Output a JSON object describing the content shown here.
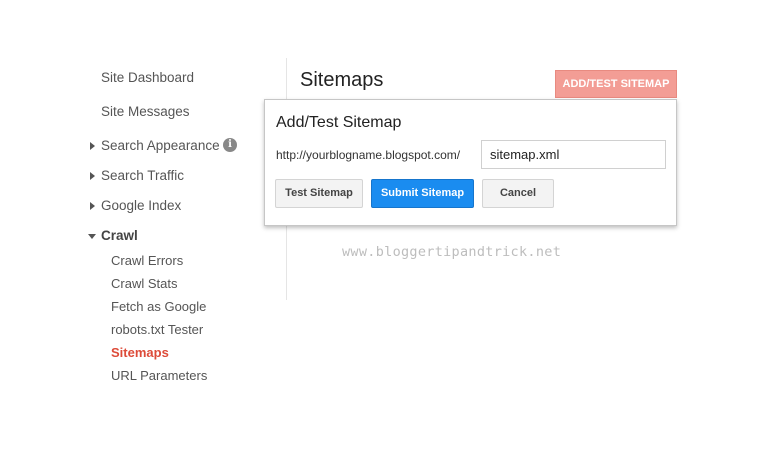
{
  "sidebar": {
    "site_dashboard": "Site Dashboard",
    "site_messages": "Site Messages",
    "search_appearance": "Search Appearance",
    "search_traffic": "Search Traffic",
    "google_index": "Google Index",
    "crawl": "Crawl",
    "crawl_items": [
      {
        "label": "Crawl Errors"
      },
      {
        "label": "Crawl Stats"
      },
      {
        "label": "Fetch as Google"
      },
      {
        "label": "robots.txt Tester"
      },
      {
        "label": "Sitemaps",
        "active": true
      },
      {
        "label": "URL Parameters"
      }
    ],
    "info_icon": "info-icon"
  },
  "main": {
    "page_title": "Sitemaps",
    "add_test_button": "ADD/TEST SITEMAP"
  },
  "dialog": {
    "title": "Add/Test Sitemap",
    "url_prefix": "http://yourblogname.blogspot.com/",
    "input_value": "sitemap.xml",
    "test_button": "Test Sitemap",
    "submit_button": "Submit Sitemap",
    "cancel_button": "Cancel"
  },
  "watermark": "www.bloggertipandtrick.net",
  "colors": {
    "accent_red": "#dd4b39",
    "add_button_bg": "#f39d95",
    "submit_blue": "#1a8cf0"
  }
}
